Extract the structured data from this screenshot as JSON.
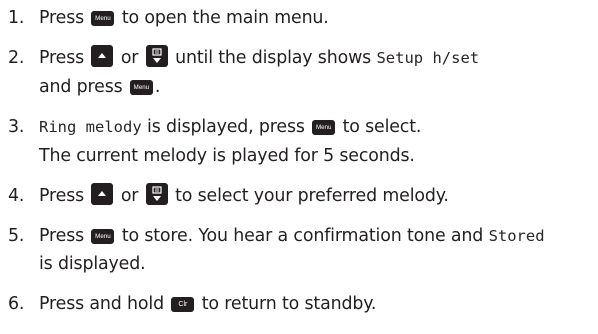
{
  "icons": {
    "menu_key": "menu-key-icon",
    "up_key": "up-arrow-key-icon",
    "down_key": "down-arrow-phonebook-key-icon",
    "clear_key": "clear-key-icon"
  },
  "key_labels": {
    "menu": "Menu",
    "clear": "Clr"
  },
  "colors": {
    "text": "#231f20",
    "key": "#231f20"
  },
  "steps": [
    {
      "number": "1.",
      "press": "Press",
      "rest": "to open the main menu."
    },
    {
      "number": "2.",
      "press": "Press",
      "or": "or",
      "until": "until the display shows",
      "display": "Setup h/set",
      "and_press": "and press",
      "end": "."
    },
    {
      "number": "3.",
      "display": "Ring melody",
      "is_displayed": "is displayed, press",
      "to_select": "to select.",
      "line2": "The current melody is played for 5 seconds."
    },
    {
      "number": "4.",
      "press": "Press",
      "or": "or",
      "rest": "to select your preferred melody."
    },
    {
      "number": "5.",
      "press": "Press",
      "rest": "to store. You hear a confirmation tone and",
      "display": "Stored",
      "line2": "is displayed."
    },
    {
      "number": "6.",
      "press": "Press and hold",
      "rest": "to return to standby."
    }
  ]
}
